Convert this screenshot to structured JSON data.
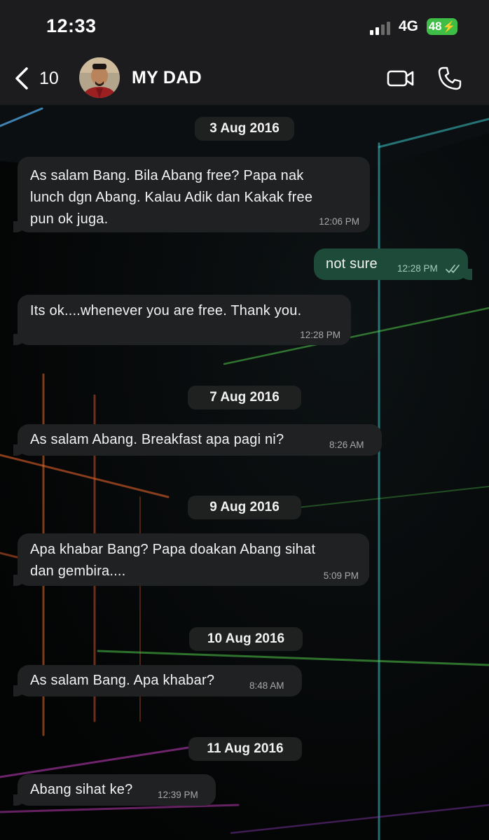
{
  "status_bar": {
    "time": "12:33",
    "network": "4G",
    "battery": "48"
  },
  "header": {
    "back_count": "10",
    "contact_name": "MY DAD"
  },
  "date_chips": [
    "3 Aug 2016",
    "7 Aug 2016",
    "9 Aug 2016",
    "10 Aug 2016",
    "11 Aug 2016"
  ],
  "messages": [
    {
      "direction": "in",
      "lines": [
        "As salam Bang. Bila Abang free? Papa nak",
        "lunch dgn Abang. Kalau Adik dan Kakak free",
        "pun ok juga."
      ],
      "time": "12:06 PM"
    },
    {
      "direction": "out",
      "lines": [
        "not sure"
      ],
      "time": "12:28 PM",
      "read": true
    },
    {
      "direction": "in",
      "lines": [
        "Its ok....whenever you are free. Thank you."
      ],
      "time": "12:28 PM"
    },
    {
      "direction": "in",
      "lines": [
        "As salam Abang. Breakfast apa pagi ni?"
      ],
      "time": "8:26 AM"
    },
    {
      "direction": "in",
      "lines": [
        "Apa khabar Bang? Papa doakan Abang sihat",
        "dan gembira...."
      ],
      "time": "5:09 PM"
    },
    {
      "direction": "in",
      "lines": [
        "As salam Bang. Apa khabar?"
      ],
      "time": "8:48 AM"
    },
    {
      "direction": "in",
      "lines": [
        "Abang sihat ke?"
      ],
      "time": "12:39 PM"
    }
  ],
  "icons": {
    "back": "chevron-left-icon",
    "video": "video-camera-icon",
    "call": "phone-icon",
    "read": "double-check-icon",
    "signal": "signal-bars-icon",
    "battery": "battery-icon"
  },
  "colors": {
    "bar_bg": "#1c1c1e",
    "incoming_bubble": "#202123",
    "outgoing_bubble": "#1d4a39",
    "battery": "#3fbe47"
  }
}
